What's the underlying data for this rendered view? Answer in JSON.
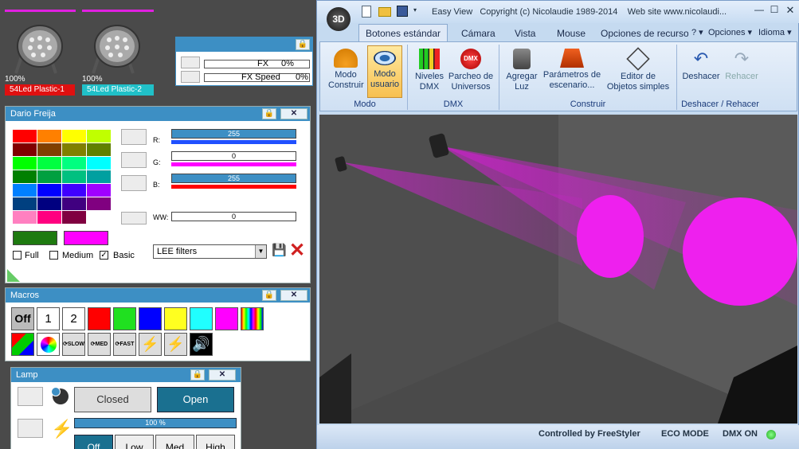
{
  "fixtures": [
    {
      "percent": "100%",
      "name": "54Led Plastic-1",
      "color": "#e01010"
    },
    {
      "percent": "100%",
      "name": "54Led Plastic-2",
      "color": "#20c0c8"
    }
  ],
  "fx_panel": {
    "fx_label": "FX",
    "fx_value": "0%",
    "speed_label": "FX Speed",
    "speed_value": "0%"
  },
  "color_panel": {
    "title": "Dario Freija",
    "r_label": "R:",
    "r_value": "255",
    "g_label": "G:",
    "g_value": "0",
    "b_label": "B:",
    "b_value": "255",
    "ww_label": "WW:",
    "ww_value": "0",
    "filter_select": "LEE filters",
    "full_label": "Full",
    "medium_label": "Medium",
    "basic_label": "Basic",
    "palette": [
      "#ff0000",
      "#ff8000",
      "#ffff00",
      "#c0ff00",
      "#800000",
      "#804000",
      "#808000",
      "#608000",
      "#00ff00",
      "#00ff40",
      "#00ff80",
      "#00ffff",
      "#008000",
      "#00a040",
      "#00c080",
      "#00a0a0",
      "#0080ff",
      "#0000ff",
      "#4000ff",
      "#a000ff",
      "#004080",
      "#000080",
      "#400080",
      "#800080",
      "#ff80c0",
      "#ff0080",
      "#800040",
      "#ffffff"
    ],
    "current_color_a": "#1e7a10",
    "current_color_b": "#ff00ff"
  },
  "macros_panel": {
    "title": "Macros",
    "off_label": "Off",
    "one_label": "1",
    "two_label": "2",
    "colors": [
      "#ff0000",
      "#20e020",
      "#0000ff",
      "#ffff20",
      "#20ffff",
      "#ff00ff"
    ]
  },
  "lamp_panel": {
    "title": "Lamp",
    "closed_label": "Closed",
    "open_label": "Open",
    "level_value": "100 %",
    "off_label": "Off",
    "low_label": "Low",
    "med_label": "Med",
    "high_label": "High"
  },
  "app": {
    "title": "Easy View   Copyright (c) Nicolaudie 1989-2014    Web site www.nicolaudi...",
    "logo": "3D",
    "tabs": [
      "Botones estándar",
      "Cámara",
      "Vista",
      "Mouse",
      "Opciones de recursos"
    ],
    "help": "?",
    "options": "Opciones",
    "language": "Idioma",
    "groups": {
      "modo": "Modo",
      "dmx": "DMX",
      "construir": "Construir",
      "deshacer": "Deshacer / Rehacer"
    },
    "buttons": {
      "modo_construir": "Modo\nConstruir",
      "modo_usuario": "Modo\nusuario",
      "niveles_dmx": "Niveles\nDMX",
      "parcheo": "Parcheo de\nUniversos",
      "agregar_luz": "Agregar\nLuz",
      "parametros": "Parámetros de\nescenario...",
      "editor": "Editor de\nObjetos simples",
      "deshacer": "Deshacer",
      "rehacer": "Rehacer"
    },
    "status": {
      "controlled": "Controlled by FreeStyler",
      "eco": "ECO MODE",
      "dmx": "DMX ON"
    }
  }
}
